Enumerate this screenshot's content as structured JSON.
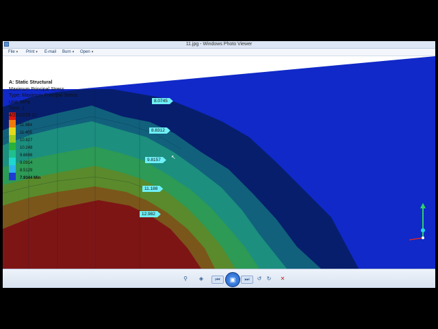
{
  "window": {
    "title": "11.jpg - Windows Photo Viewer"
  },
  "menu": [
    {
      "label": "File",
      "has_dropdown": true
    },
    {
      "label": "Print",
      "has_dropdown": true
    },
    {
      "label": "E-mail",
      "has_dropdown": false
    },
    {
      "label": "Burn",
      "has_dropdown": true
    },
    {
      "label": "Open",
      "has_dropdown": true
    }
  ],
  "analysis": {
    "header": "A: Static Structural",
    "result": "Maximum Principal Stress",
    "type": "Type: Maximum Principal Stress",
    "unit": "Unit: MPa",
    "time": "Time: 1",
    "date": "4/22/2019 11:"
  },
  "legend": {
    "labels": [
      "11.984",
      "11.405",
      "10.827",
      "10.248",
      "9.6698",
      "9.0914",
      "8.5129"
    ],
    "min_label": "7.9344 Min",
    "colors": [
      "#d9160f",
      "#f07a0e",
      "#e4d91a",
      "#9acb21",
      "#28b23c",
      "#1fc08d",
      "#1fd7cf",
      "#2db2ee",
      "#1f3cd0"
    ]
  },
  "probes": [
    "8.0745",
    "8.8312",
    "9.8157",
    "11.188",
    "12.982"
  ],
  "colors": {
    "titlebar": "#dce6f4",
    "viewport_bg": "#1029c8",
    "probe": "#6ff0f7"
  }
}
